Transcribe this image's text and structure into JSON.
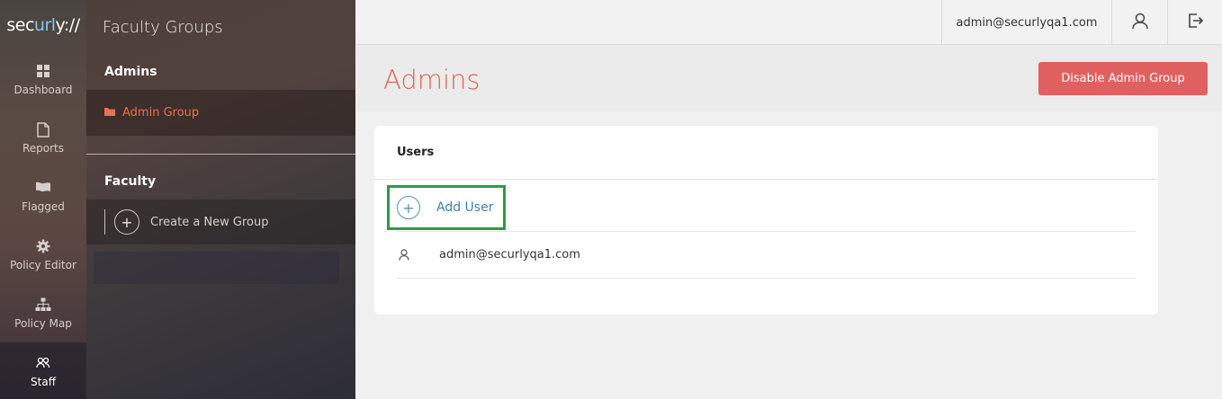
{
  "brand": {
    "prefix": "sec",
    "accent": "url",
    "suffix": "y://"
  },
  "nav": [
    {
      "label": "Dashboard",
      "icon": "dashboard-icon"
    },
    {
      "label": "Reports",
      "icon": "document-icon"
    },
    {
      "label": "Flagged",
      "icon": "flag-icon"
    },
    {
      "label": "Policy Editor",
      "icon": "gear-icon"
    },
    {
      "label": "Policy Map",
      "icon": "sitemap-icon"
    },
    {
      "label": "Staff",
      "icon": "users-icon",
      "active": true
    }
  ],
  "groups_panel": {
    "title": "Faculty Groups",
    "admins_heading": "Admins",
    "admin_group_label": "Admin Group",
    "faculty_heading": "Faculty",
    "create_group_label": "Create a New Group"
  },
  "topbar": {
    "email": "admin@securlyqa1.com"
  },
  "header": {
    "title": "Admins",
    "disable_button": "Disable Admin Group"
  },
  "card": {
    "heading": "Users",
    "add_user_label": "Add User",
    "users": [
      {
        "email": "admin@securlyqa1.com"
      }
    ]
  },
  "colors": {
    "accent": "#e0654a",
    "danger_button": "#e06060",
    "link": "#3e7fb0",
    "highlight_border": "#2a9c48"
  }
}
